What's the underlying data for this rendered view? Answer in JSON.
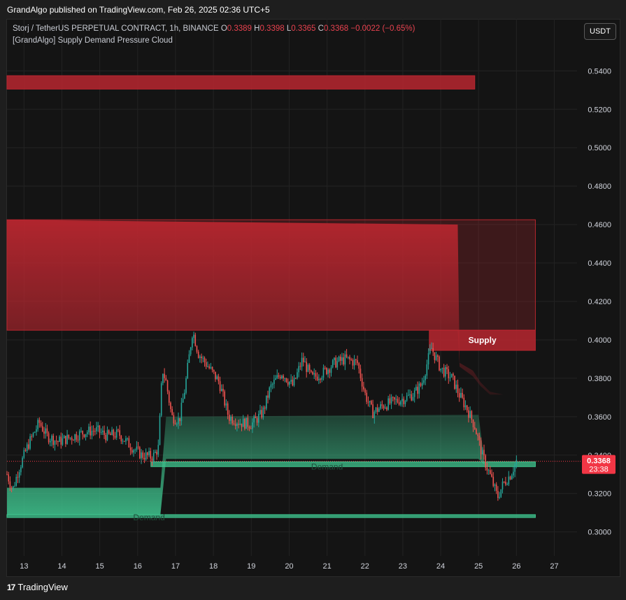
{
  "publisher_line": "GrandAlgo published on TradingView.com, Feb 26, 2025 02:36 UTC+5",
  "header": {
    "symbol": "Storj / TetherUS PERPETUAL CONTRACT, 1h, BINANCE",
    "o_label": "O",
    "o_value": "0.3389",
    "h_label": "H",
    "h_value": "0.3398",
    "l_label": "L",
    "l_value": "0.3365",
    "c_label": "C",
    "c_value": "0.3368",
    "change": "−0.0022 (−0.65%)",
    "indicator": "[GrandAlgo] Supply Demand Pressure Cloud"
  },
  "currency_button": "USDT",
  "price_label": {
    "price": "0.3368",
    "countdown": "23:38"
  },
  "footer": {
    "brand": "TradingView",
    "logo_text": "17"
  },
  "colors": {
    "supply": "#b7262f",
    "demand": "#3fc58f",
    "up": "#26a69a",
    "down": "#ef5350",
    "last_price": "#f23645"
  },
  "zone_labels": {
    "supply": "Supply",
    "demand": "Demand"
  },
  "chart_data": {
    "type": "candlestick",
    "title": "Storj / TetherUS PERPETUAL CONTRACT, 1h, BINANCE",
    "x_ticks": [
      "13",
      "14",
      "15",
      "16",
      "17",
      "18",
      "19",
      "20",
      "21",
      "22",
      "23",
      "24",
      "25",
      "26",
      "27"
    ],
    "x_range": [
      12.55,
      27.6
    ],
    "y_ticks": [
      "0.5400",
      "0.5200",
      "0.5000",
      "0.4800",
      "0.4600",
      "0.4400",
      "0.4200",
      "0.4000",
      "0.3800",
      "0.3600",
      "0.3400",
      "0.3200",
      "0.3000"
    ],
    "y_range": [
      0.2875,
      0.5525
    ],
    "last_price": 0.3368,
    "price_path": [
      [
        12.55,
        0.33
      ],
      [
        12.7,
        0.322
      ],
      [
        12.85,
        0.332
      ],
      [
        13.1,
        0.345
      ],
      [
        13.4,
        0.357
      ],
      [
        13.6,
        0.35
      ],
      [
        13.9,
        0.347
      ],
      [
        14.2,
        0.349
      ],
      [
        14.6,
        0.352
      ],
      [
        14.9,
        0.353
      ],
      [
        15.2,
        0.35
      ],
      [
        15.5,
        0.351
      ],
      [
        15.8,
        0.345
      ],
      [
        16.1,
        0.34
      ],
      [
        16.4,
        0.339
      ],
      [
        16.55,
        0.344
      ],
      [
        16.65,
        0.385
      ],
      [
        16.75,
        0.378
      ],
      [
        16.9,
        0.36
      ],
      [
        17.1,
        0.358
      ],
      [
        17.25,
        0.375
      ],
      [
        17.45,
        0.405
      ],
      [
        17.6,
        0.393
      ],
      [
        17.9,
        0.385
      ],
      [
        18.15,
        0.378
      ],
      [
        18.4,
        0.36
      ],
      [
        18.7,
        0.357
      ],
      [
        19.0,
        0.356
      ],
      [
        19.3,
        0.362
      ],
      [
        19.5,
        0.375
      ],
      [
        19.8,
        0.383
      ],
      [
        20.1,
        0.376
      ],
      [
        20.35,
        0.39
      ],
      [
        20.6,
        0.38
      ],
      [
        20.9,
        0.383
      ],
      [
        21.2,
        0.388
      ],
      [
        21.5,
        0.39
      ],
      [
        21.8,
        0.388
      ],
      [
        22.0,
        0.372
      ],
      [
        22.2,
        0.362
      ],
      [
        22.5,
        0.366
      ],
      [
        22.8,
        0.368
      ],
      [
        23.1,
        0.37
      ],
      [
        23.3,
        0.372
      ],
      [
        23.5,
        0.377
      ],
      [
        23.75,
        0.396
      ],
      [
        24.0,
        0.385
      ],
      [
        24.3,
        0.38
      ],
      [
        24.5,
        0.371
      ],
      [
        24.7,
        0.364
      ],
      [
        24.9,
        0.355
      ],
      [
        25.1,
        0.34
      ],
      [
        25.35,
        0.327
      ],
      [
        25.5,
        0.318
      ],
      [
        25.65,
        0.325
      ],
      [
        25.85,
        0.33
      ],
      [
        26.0,
        0.337
      ]
    ],
    "supply_zones": [
      {
        "x_start": 12.55,
        "x_end": 24.9,
        "top": 0.5375,
        "bottom": 0.5305
      },
      {
        "x_start": 12.55,
        "x_end": 26.5,
        "top": 0.4625,
        "bottom": 0.405
      },
      {
        "x_start": 23.7,
        "x_end": 26.5,
        "top": 0.405,
        "bottom": 0.3945,
        "label": "Supply"
      }
    ],
    "demand_zones": [
      {
        "x_start": 16.35,
        "x_end": 26.5,
        "top": 0.3365,
        "bottom": 0.334,
        "label": "Demand"
      },
      {
        "x_start": 12.55,
        "x_end": 26.5,
        "top": 0.309,
        "bottom": 0.3075,
        "label": "Demand"
      }
    ],
    "supply_cloud": [
      [
        12.55,
        0.4625,
        0.405
      ],
      [
        24.45,
        0.46,
        0.405
      ],
      [
        24.5,
        0.388,
        0.386
      ],
      [
        24.85,
        0.384,
        0.381
      ],
      [
        25.05,
        0.378,
        0.376
      ],
      [
        25.3,
        0.373,
        0.3715
      ],
      [
        25.65,
        0.3715,
        0.3715
      ]
    ],
    "demand_cloud": [
      [
        12.55,
        0.323,
        0.309
      ],
      [
        16.6,
        0.323,
        0.309
      ],
      [
        16.75,
        0.36,
        0.338
      ],
      [
        25.0,
        0.361,
        0.338
      ],
      [
        25.15,
        0.337,
        0.335
      ]
    ]
  }
}
